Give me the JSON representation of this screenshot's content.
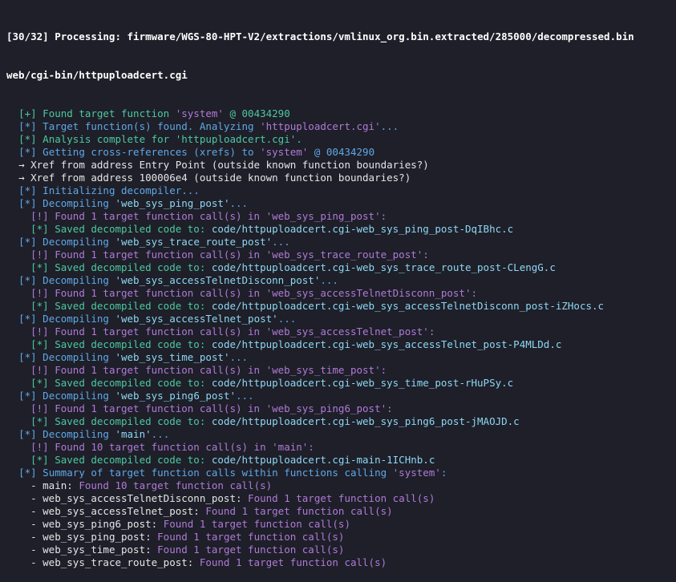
{
  "colors": {
    "background": "#1e1f29",
    "blue": "#5fa8e6",
    "cyan": "#8fd7f2",
    "green": "#4cc9a0",
    "magenta": "#b07ad6",
    "white": "#e6e6e6"
  },
  "header": {
    "line1": "[30/32] Processing: firmware/WGS-80-HPT-V2/extractions/vmlinux_org.bin.extracted/285000/decompressed.bin",
    "line2": "web/cgi-bin/httpuploadcert.cgi"
  },
  "lines": [
    {
      "indent": "  ",
      "segments": [
        {
          "t": "[+] Found target function ",
          "c": "gr"
        },
        {
          "t": "'system'",
          "c": "mg"
        },
        {
          "t": " @ 00434290",
          "c": "gr"
        }
      ]
    },
    {
      "indent": "  ",
      "segments": [
        {
          "t": "[*] Target function(s) found. Analyzing ",
          "c": "bl"
        },
        {
          "t": "'httpuploadcert.cgi'",
          "c": "mg"
        },
        {
          "t": "...",
          "c": "bl"
        }
      ]
    },
    {
      "indent": "  ",
      "segments": [
        {
          "t": "[*] Analysis complete for ",
          "c": "gr"
        },
        {
          "t": "'httpuploadcert.cgi'",
          "c": "gr"
        },
        {
          "t": ".",
          "c": "gr"
        }
      ]
    },
    {
      "indent": "  ",
      "segments": [
        {
          "t": "[*] Getting cross-references (xrefs) to ",
          "c": "bl"
        },
        {
          "t": "'system'",
          "c": "mg"
        },
        {
          "t": " @ 00434290",
          "c": "bl"
        }
      ]
    },
    {
      "indent": "  ",
      "segments": [
        {
          "t": "→ Xref from address Entry Point (outside known function boundaries?)",
          "c": "wh"
        }
      ]
    },
    {
      "indent": "  ",
      "segments": [
        {
          "t": "→ Xref from address 100006e4 (outside known function boundaries?)",
          "c": "wh"
        }
      ]
    },
    {
      "indent": "  ",
      "segments": [
        {
          "t": "[*] Initializing decompiler...",
          "c": "bl"
        }
      ]
    },
    {
      "indent": "  ",
      "segments": [
        {
          "t": "[*] Decompiling ",
          "c": "bl"
        },
        {
          "t": "'web_sys_ping_post'",
          "c": "cy"
        },
        {
          "t": "...",
          "c": "bl"
        }
      ]
    },
    {
      "indent": "    ",
      "segments": [
        {
          "t": "[!] Found 1 target function call(s) in ",
          "c": "mg"
        },
        {
          "t": "'web_sys_ping_post'",
          "c": "mg"
        },
        {
          "t": ":",
          "c": "mg"
        }
      ]
    },
    {
      "indent": "    ",
      "segments": [
        {
          "t": "[*] Saved decompiled code to: ",
          "c": "gr"
        },
        {
          "t": "code/httpuploadcert.cgi-web_sys_ping_post-DqIBhc.c",
          "c": "cy"
        }
      ]
    },
    {
      "indent": "  ",
      "segments": [
        {
          "t": "[*] Decompiling ",
          "c": "bl"
        },
        {
          "t": "'web_sys_trace_route_post'",
          "c": "cy"
        },
        {
          "t": "...",
          "c": "bl"
        }
      ]
    },
    {
      "indent": "    ",
      "segments": [
        {
          "t": "[!] Found 1 target function call(s) in ",
          "c": "mg"
        },
        {
          "t": "'web_sys_trace_route_post'",
          "c": "mg"
        },
        {
          "t": ":",
          "c": "mg"
        }
      ]
    },
    {
      "indent": "    ",
      "segments": [
        {
          "t": "[*] Saved decompiled code to: ",
          "c": "gr"
        },
        {
          "t": "code/httpuploadcert.cgi-web_sys_trace_route_post-CLengG.c",
          "c": "cy"
        }
      ]
    },
    {
      "indent": "  ",
      "segments": [
        {
          "t": "[*] Decompiling ",
          "c": "bl"
        },
        {
          "t": "'web_sys_accessTelnetDisconn_post'",
          "c": "cy"
        },
        {
          "t": "...",
          "c": "bl"
        }
      ]
    },
    {
      "indent": "    ",
      "segments": [
        {
          "t": "[!] Found 1 target function call(s) in ",
          "c": "mg"
        },
        {
          "t": "'web_sys_accessTelnetDisconn_post'",
          "c": "mg"
        },
        {
          "t": ":",
          "c": "mg"
        }
      ]
    },
    {
      "indent": "    ",
      "segments": [
        {
          "t": "[*] Saved decompiled code to: ",
          "c": "gr"
        },
        {
          "t": "code/httpuploadcert.cgi-web_sys_accessTelnetDisconn_post-iZHocs.c",
          "c": "cy"
        }
      ]
    },
    {
      "indent": "  ",
      "segments": [
        {
          "t": "[*] Decompiling ",
          "c": "bl"
        },
        {
          "t": "'web_sys_accessTelnet_post'",
          "c": "cy"
        },
        {
          "t": "...",
          "c": "bl"
        }
      ]
    },
    {
      "indent": "    ",
      "segments": [
        {
          "t": "[!] Found 1 target function call(s) in ",
          "c": "mg"
        },
        {
          "t": "'web_sys_accessTelnet_post'",
          "c": "mg"
        },
        {
          "t": ":",
          "c": "mg"
        }
      ]
    },
    {
      "indent": "    ",
      "segments": [
        {
          "t": "[*] Saved decompiled code to: ",
          "c": "gr"
        },
        {
          "t": "code/httpuploadcert.cgi-web_sys_accessTelnet_post-P4MLDd.c",
          "c": "cy"
        }
      ]
    },
    {
      "indent": "  ",
      "segments": [
        {
          "t": "[*] Decompiling ",
          "c": "bl"
        },
        {
          "t": "'web_sys_time_post'",
          "c": "cy"
        },
        {
          "t": "...",
          "c": "bl"
        }
      ]
    },
    {
      "indent": "    ",
      "segments": [
        {
          "t": "[!] Found 1 target function call(s) in ",
          "c": "mg"
        },
        {
          "t": "'web_sys_time_post'",
          "c": "mg"
        },
        {
          "t": ":",
          "c": "mg"
        }
      ]
    },
    {
      "indent": "    ",
      "segments": [
        {
          "t": "[*] Saved decompiled code to: ",
          "c": "gr"
        },
        {
          "t": "code/httpuploadcert.cgi-web_sys_time_post-rHuPSy.c",
          "c": "cy"
        }
      ]
    },
    {
      "indent": "  ",
      "segments": [
        {
          "t": "[*] Decompiling ",
          "c": "bl"
        },
        {
          "t": "'web_sys_ping6_post'",
          "c": "cy"
        },
        {
          "t": "...",
          "c": "bl"
        }
      ]
    },
    {
      "indent": "    ",
      "segments": [
        {
          "t": "[!] Found 1 target function call(s) in ",
          "c": "mg"
        },
        {
          "t": "'web_sys_ping6_post'",
          "c": "mg"
        },
        {
          "t": ":",
          "c": "mg"
        }
      ]
    },
    {
      "indent": "    ",
      "segments": [
        {
          "t": "[*] Saved decompiled code to: ",
          "c": "gr"
        },
        {
          "t": "code/httpuploadcert.cgi-web_sys_ping6_post-jMAOJD.c",
          "c": "cy"
        }
      ]
    },
    {
      "indent": "  ",
      "segments": [
        {
          "t": "[*] Decompiling ",
          "c": "bl"
        },
        {
          "t": "'main'",
          "c": "cy"
        },
        {
          "t": "...",
          "c": "bl"
        }
      ]
    },
    {
      "indent": "    ",
      "segments": [
        {
          "t": "[!] Found 10 target function call(s) in ",
          "c": "mg"
        },
        {
          "t": "'main'",
          "c": "mg"
        },
        {
          "t": ":",
          "c": "mg"
        }
      ]
    },
    {
      "indent": "    ",
      "segments": [
        {
          "t": "[*] Saved decompiled code to: ",
          "c": "gr"
        },
        {
          "t": "code/httpuploadcert.cgi-main-1ICHnb.c",
          "c": "cy"
        }
      ]
    },
    {
      "indent": "  ",
      "segments": [
        {
          "t": "[*] Summary of target function calls within functions calling ",
          "c": "bl"
        },
        {
          "t": "'system'",
          "c": "mg"
        },
        {
          "t": ":",
          "c": "bl"
        }
      ]
    },
    {
      "indent": "    ",
      "segments": [
        {
          "t": "- main: ",
          "c": "wh"
        },
        {
          "t": "Found 10 target function call(s)",
          "c": "mg"
        }
      ]
    },
    {
      "indent": "    ",
      "segments": [
        {
          "t": "- web_sys_accessTelnetDisconn_post: ",
          "c": "wh"
        },
        {
          "t": "Found 1 target function call(s)",
          "c": "mg"
        }
      ]
    },
    {
      "indent": "    ",
      "segments": [
        {
          "t": "- web_sys_accessTelnet_post: ",
          "c": "wh"
        },
        {
          "t": "Found 1 target function call(s)",
          "c": "mg"
        }
      ]
    },
    {
      "indent": "    ",
      "segments": [
        {
          "t": "- web_sys_ping6_post: ",
          "c": "wh"
        },
        {
          "t": "Found 1 target function call(s)",
          "c": "mg"
        }
      ]
    },
    {
      "indent": "    ",
      "segments": [
        {
          "t": "- web_sys_ping_post: ",
          "c": "wh"
        },
        {
          "t": "Found 1 target function call(s)",
          "c": "mg"
        }
      ]
    },
    {
      "indent": "    ",
      "segments": [
        {
          "t": "- web_sys_time_post: ",
          "c": "wh"
        },
        {
          "t": "Found 1 target function call(s)",
          "c": "mg"
        }
      ]
    },
    {
      "indent": "    ",
      "segments": [
        {
          "t": "- web_sys_trace_route_post: ",
          "c": "wh"
        },
        {
          "t": "Found 1 target function call(s)",
          "c": "mg"
        }
      ]
    }
  ]
}
